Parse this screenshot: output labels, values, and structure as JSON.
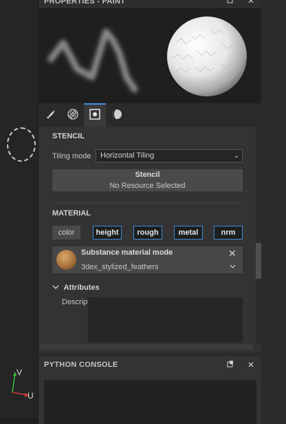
{
  "properties": {
    "title": "PROPERTIES - PAINT",
    "icons": [
      "popout-icon",
      "close-icon"
    ]
  },
  "tabs": [
    {
      "icon": "brush-icon"
    },
    {
      "icon": "material-ball-icon"
    },
    {
      "icon": "stencil-icon",
      "active": true
    },
    {
      "icon": "environment-icon"
    }
  ],
  "stencil": {
    "section_title": "STENCIL",
    "tiling_label": "Tiling mode",
    "tiling_value": "Horizontal Tiling",
    "box_title": "Stencil",
    "box_status": "No Resource Selected"
  },
  "material": {
    "section_title": "MATERIAL",
    "channels": [
      {
        "label": "color",
        "enabled": false
      },
      {
        "label": "height",
        "enabled": true
      },
      {
        "label": "rough",
        "enabled": true
      },
      {
        "label": "metal",
        "enabled": true
      },
      {
        "label": "nrm",
        "enabled": true
      }
    ],
    "mode_title": "Substance material mode",
    "resource_name": "3dex_stylized_feathers"
  },
  "attributes": {
    "title": "Attributes",
    "description_label": "Description"
  },
  "console": {
    "title": "PYTHON CONSOLE"
  },
  "viewport": {
    "axis_v": "V",
    "axis_u": "U"
  },
  "colors": {
    "accent": "#3f8ad9",
    "axis_green": "#3cc23c",
    "axis_red": "#d83a3a"
  }
}
